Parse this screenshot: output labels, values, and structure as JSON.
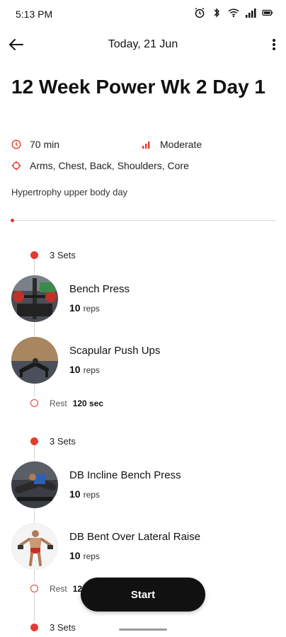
{
  "status_bar": {
    "time": "5:13 PM",
    "icons": [
      "alarm-icon",
      "bluetooth-icon",
      "wifi-icon",
      "signal-icon",
      "battery-icon"
    ]
  },
  "app_bar": {
    "title": "Today, 21 Jun"
  },
  "workout": {
    "title": "12 Week Power Wk 2 Day 1",
    "duration": "70 min",
    "intensity": "Moderate",
    "muscles": "Arms, Chest, Back, Shoulders, Core",
    "description": "Hypertrophy upper body day",
    "progress": 0
  },
  "groups": [
    {
      "sets_label": "3 Sets",
      "exercises": [
        {
          "name": "Bench Press",
          "reps": "10",
          "unit": "reps"
        },
        {
          "name": "Scapular Push Ups",
          "reps": "10",
          "unit": "reps"
        }
      ],
      "rest": {
        "label": "Rest",
        "value": "120 sec"
      }
    },
    {
      "sets_label": "3 Sets",
      "exercises": [
        {
          "name": "DB Incline Bench Press",
          "reps": "10",
          "unit": "reps"
        },
        {
          "name": "DB Bent Over Lateral Raise",
          "reps": "10",
          "unit": "reps"
        }
      ],
      "rest": {
        "label": "Rest",
        "value": "12"
      }
    },
    {
      "sets_label": "3 Sets"
    }
  ],
  "start_button": {
    "label": "Start"
  },
  "colors": {
    "accent": "#e53b2f",
    "button_bg": "#111111"
  }
}
